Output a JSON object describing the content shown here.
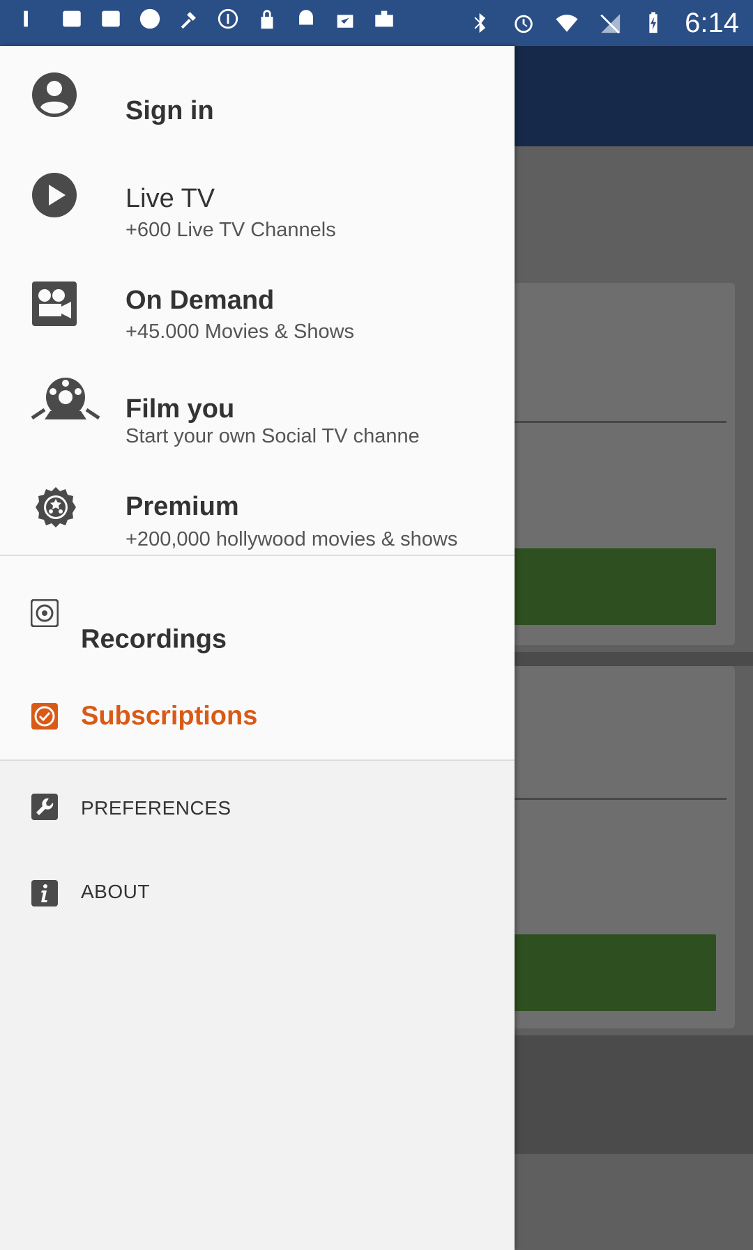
{
  "status_bar": {
    "time": "6:14",
    "left_icons": [
      "app-icon",
      "app-icon",
      "app-icon",
      "shazam-icon",
      "satellite-icon",
      "info-circle-icon",
      "lock-icon",
      "android-icon",
      "clipboard-check-icon",
      "briefcase-icon"
    ],
    "right_icons": [
      "bluetooth-icon",
      "alarm-icon",
      "wifi-icon",
      "no-signal-icon",
      "battery-charging-icon"
    ]
  },
  "drawer": {
    "sign_in": {
      "title": "Sign in",
      "icon": "account-icon"
    },
    "live_tv": {
      "title": "Live TV",
      "subtitle": "+600 Live TV Channels",
      "icon": "play-icon"
    },
    "on_demand": {
      "title": "On Demand",
      "subtitle": "+45.000 Movies & Shows",
      "icon": "movie-camera-icon"
    },
    "film_you": {
      "title": "Film you",
      "subtitle": "Start your own Social TV channe",
      "icon": "film-reel-icon"
    },
    "premium": {
      "title": "Premium",
      "subtitle": "+200,000 hollywood movies & shows",
      "icon": "premium-badge-icon"
    },
    "recordings": {
      "label": "Recordings",
      "icon": "record-icon"
    },
    "subscriptions": {
      "label": "Subscriptions",
      "icon": "check-box-icon"
    },
    "preferences": {
      "label": "PREFERENCES",
      "icon": "wrench-icon"
    },
    "about": {
      "label": "ABOUT",
      "icon": "info-icon"
    }
  },
  "colors": {
    "status_bar": "#2a4f86",
    "accent": "#d95a16",
    "icon_gray": "#4a4a4a",
    "backdrop_header": "#16294a",
    "backdrop_button": "#2e4f20"
  }
}
